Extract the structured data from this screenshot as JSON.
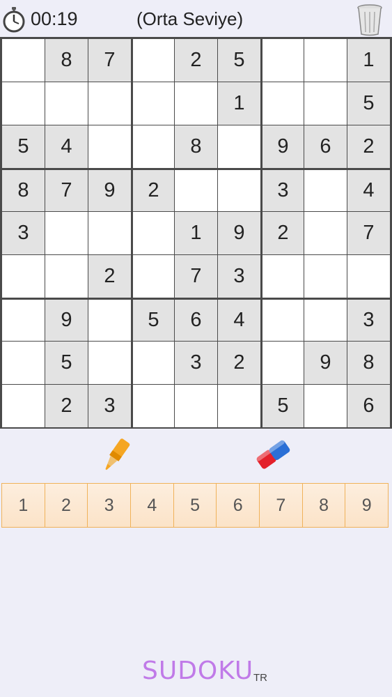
{
  "header": {
    "timer": "00:19",
    "level": "(Orta Seviye)",
    "timer_icon": "stopwatch-icon",
    "trash_icon": "trash-icon"
  },
  "board": {
    "grid": [
      [
        "",
        "8",
        "7",
        "",
        "2",
        "5",
        "",
        "",
        "1"
      ],
      [
        "",
        "",
        "",
        "",
        "",
        "1",
        "",
        "",
        "5"
      ],
      [
        "5",
        "4",
        "",
        "",
        "8",
        "",
        "9",
        "6",
        "2"
      ],
      [
        "8",
        "7",
        "9",
        "2",
        "",
        "",
        "3",
        "",
        "4"
      ],
      [
        "3",
        "",
        "",
        "",
        "1",
        "9",
        "2",
        "",
        "7"
      ],
      [
        "",
        "",
        "2",
        "",
        "7",
        "3",
        "",
        "",
        ""
      ],
      [
        "",
        "9",
        "",
        "5",
        "6",
        "4",
        "",
        "",
        "3"
      ],
      [
        "",
        "5",
        "",
        "",
        "3",
        "2",
        "",
        "9",
        "8"
      ],
      [
        "",
        "2",
        "3",
        "",
        "",
        "",
        "5",
        "",
        "6"
      ]
    ]
  },
  "tools": {
    "marker_icon": "highlighter-icon",
    "eraser_icon": "eraser-icon"
  },
  "numpad": {
    "keys": [
      "1",
      "2",
      "3",
      "4",
      "5",
      "6",
      "7",
      "8",
      "9"
    ]
  },
  "brand": {
    "logo": "SUDOKU",
    "sub": "TR"
  },
  "colors": {
    "background": "#eeeef8",
    "given_cell": "#e3e3e3",
    "empty_cell": "#ffffff",
    "grid_line": "#4a4a4a",
    "numpad_border": "#f0b25a",
    "logo": "#c07ae8"
  }
}
